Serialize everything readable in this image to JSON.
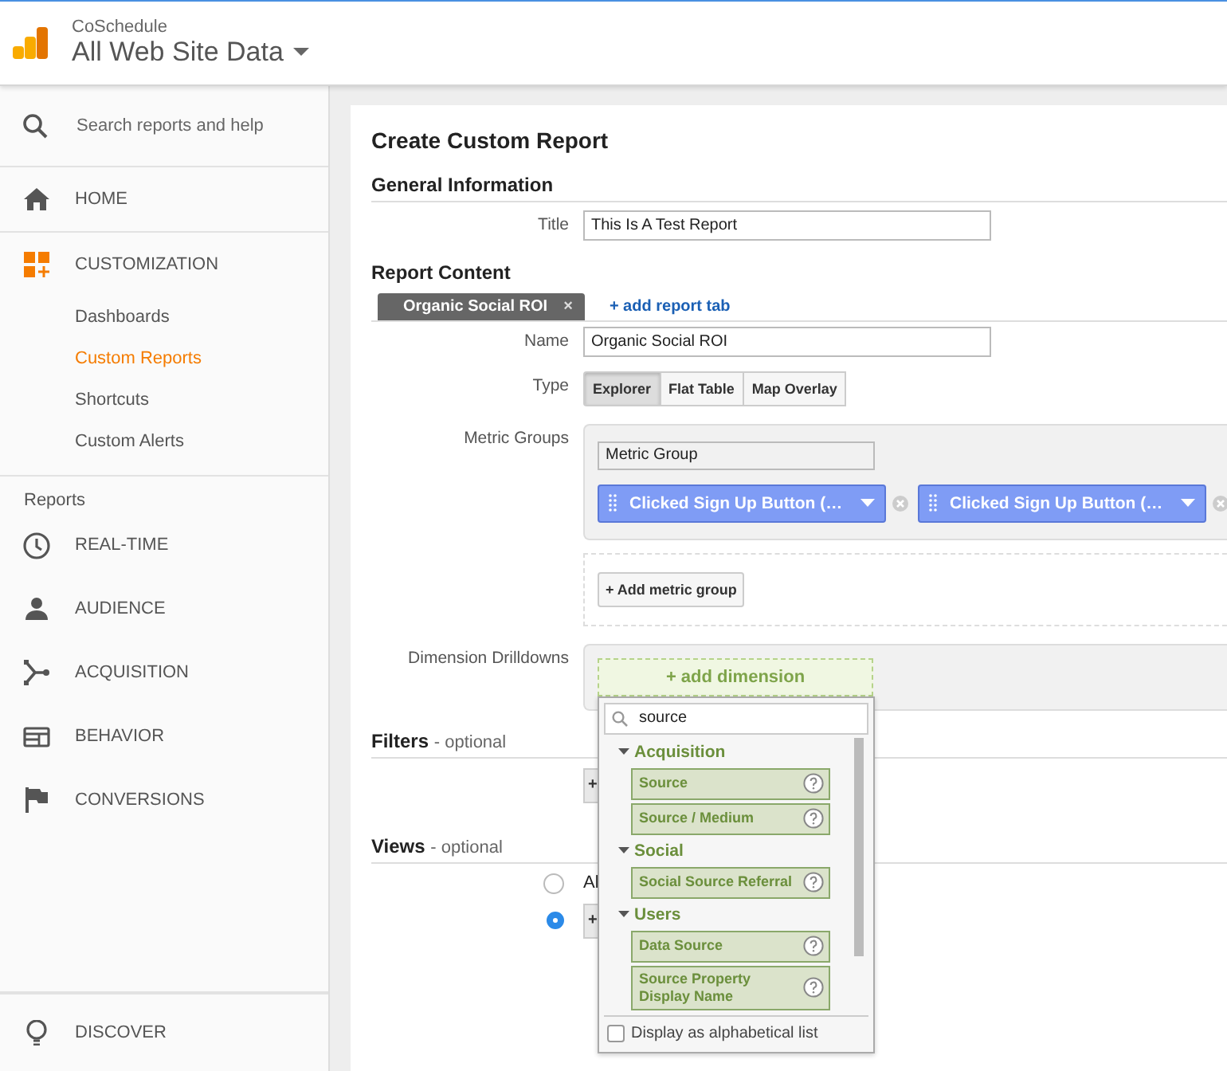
{
  "header": {
    "account": "CoSchedule",
    "property": "All Web Site Data"
  },
  "sidebar": {
    "search_placeholder": "Search reports and help",
    "sections": [
      {
        "items": [
          {
            "kind": "nav",
            "label": "HOME",
            "selected": false
          }
        ]
      },
      {
        "items": [
          {
            "kind": "nav",
            "label": "CUSTOMIZATION",
            "selected": false
          },
          {
            "kind": "sub",
            "label": "Dashboards",
            "selected": false
          },
          {
            "kind": "sub",
            "label": "Custom Reports",
            "selected": true
          },
          {
            "kind": "sub",
            "label": "Shortcuts",
            "selected": false
          },
          {
            "kind": "sub",
            "label": "Custom Alerts",
            "selected": false
          }
        ]
      },
      {
        "items": [
          {
            "kind": "heading",
            "label": "Reports"
          },
          {
            "kind": "nav",
            "label": "REAL-TIME",
            "selected": false
          },
          {
            "kind": "nav",
            "label": "AUDIENCE",
            "selected": false
          },
          {
            "kind": "nav",
            "label": "ACQUISITION",
            "selected": false
          },
          {
            "kind": "nav",
            "label": "BEHAVIOR",
            "selected": false
          },
          {
            "kind": "nav",
            "label": "CONVERSIONS",
            "selected": false
          }
        ]
      },
      {
        "items": [
          {
            "kind": "nav",
            "label": "DISCOVER",
            "selected": false
          }
        ]
      }
    ]
  },
  "form": {
    "title": "Create Custom Report",
    "general": {
      "heading": "General Information",
      "title_label": "Title",
      "title_value": "This Is A Test Report"
    },
    "content": {
      "heading": "Report Content",
      "tabs": [
        {
          "label": "Organic Social ROI",
          "close": "×",
          "selected": true
        }
      ],
      "add_tab": "+ add report tab",
      "name_label": "Name",
      "name_value": "Organic Social ROI",
      "type_label": "Type",
      "types": [
        {
          "label": "Explorer",
          "selected": true
        },
        {
          "label": "Flat Table",
          "selected": false
        },
        {
          "label": "Map Overlay",
          "selected": false
        }
      ],
      "metric_label": "Metric Groups",
      "metric_group_name": "Metric Group",
      "metrics": [
        {
          "label": "Clicked Sign Up Button (…"
        },
        {
          "label": "Clicked Sign Up Button (…"
        }
      ],
      "add_metric_group": "+ Add metric group",
      "dimension_label": "Dimension Drilldowns",
      "add_dimension": "+ add dimension"
    },
    "filters": {
      "heading": "Filters",
      "note": "- optional",
      "button": "+"
    },
    "views": {
      "heading": "Views",
      "note": "- optional",
      "options": [
        {
          "label": "Al",
          "selected": false
        },
        {
          "label": "+",
          "selected": true
        }
      ]
    }
  },
  "dimension_picker": {
    "search_value": "source",
    "groups": [
      {
        "label": "Acquisition",
        "expanded": true,
        "items": [
          {
            "label": "Source"
          },
          {
            "label": "Source / Medium"
          }
        ]
      },
      {
        "label": "Social",
        "expanded": true,
        "items": [
          {
            "label": "Social Source Referral"
          }
        ]
      },
      {
        "label": "Users",
        "expanded": true,
        "items": [
          {
            "label": "Data Source"
          },
          {
            "label": "Source Property Display Name"
          }
        ]
      }
    ],
    "alphabetical": {
      "label": "Display as alphabetical list",
      "checked": false
    }
  }
}
